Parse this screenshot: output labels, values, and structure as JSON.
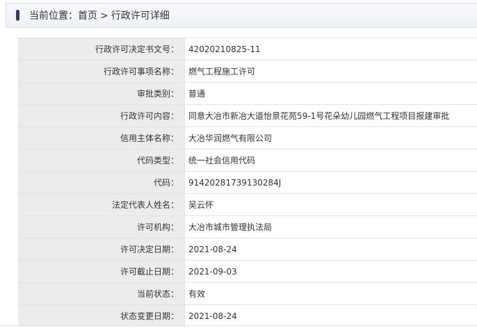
{
  "breadcrumb": {
    "location_label": "当前位置：",
    "home": "首页",
    "separator": ">",
    "current": "行政许可详细"
  },
  "rows": [
    {
      "label": "行政许可决定书文号：",
      "value": "42020210825-11"
    },
    {
      "label": "行政许可事项名称：",
      "value": "燃气工程施工许可"
    },
    {
      "label": "审批类别：",
      "value": "普通"
    },
    {
      "label": "行政许可内容：",
      "value": "同意大冶市新冶大道怡景花苑59-1号花朵幼儿园燃气工程项目报建审批"
    },
    {
      "label": "信用主体名称：",
      "value": "大冶华润燃气有限公司"
    },
    {
      "label": "代码类型：",
      "value": "统一社会信用代码"
    },
    {
      "label": "代码：",
      "value": "91420281739130284J"
    },
    {
      "label": "法定代表人姓名：",
      "value": "吴云怀"
    },
    {
      "label": "许可机构：",
      "value": "大冶市城市管理执法局"
    },
    {
      "label": "许可决定日期：",
      "value": "2021-08-24"
    },
    {
      "label": "许可截止日期：",
      "value": "2021-09-03"
    },
    {
      "label": "当前状态：",
      "value": "有效"
    },
    {
      "label": "状态变更日期：",
      "value": "2021-08-24"
    }
  ],
  "colors": {
    "marker": "#2c3f64",
    "label_bg": "#ececec",
    "border": "#e3e3e3"
  }
}
